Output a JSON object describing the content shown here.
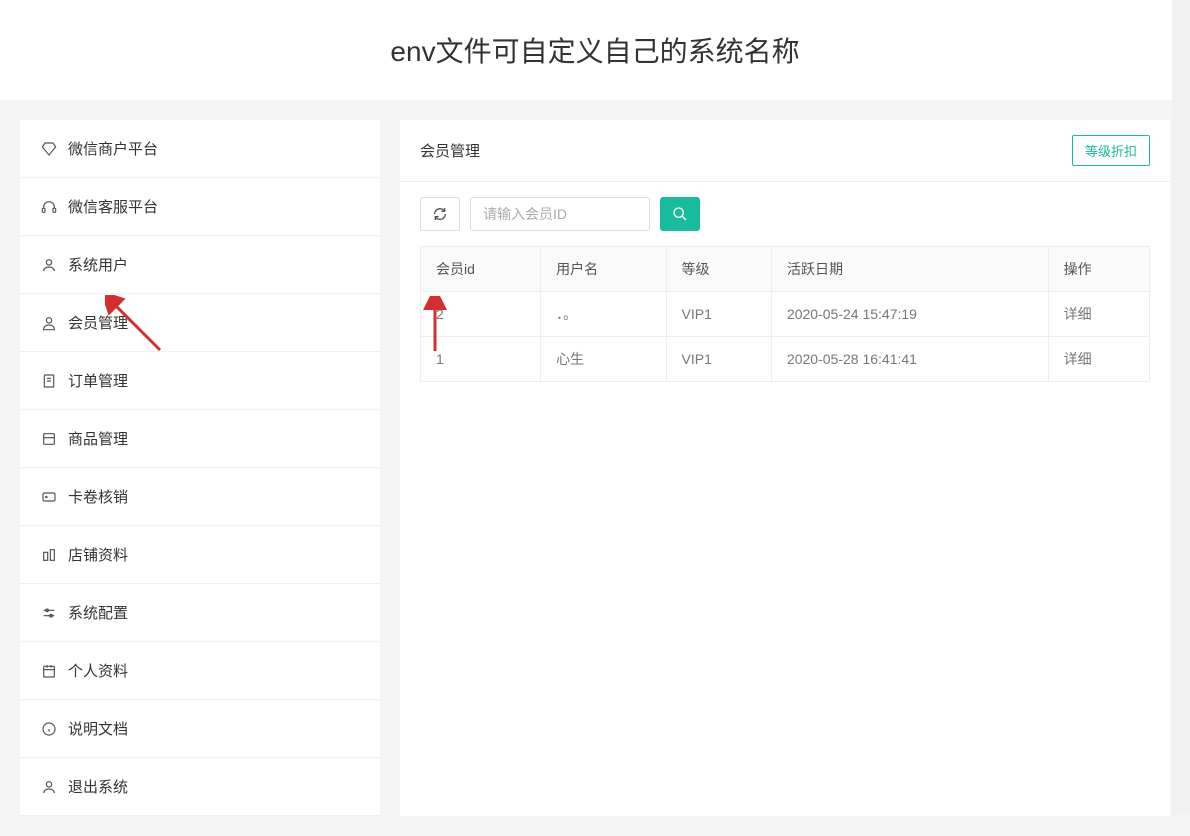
{
  "header": {
    "title": "env文件可自定义自己的系统名称"
  },
  "sidebar": {
    "items": [
      {
        "label": "微信商户平台",
        "icon": "diamond-icon"
      },
      {
        "label": "微信客服平台",
        "icon": "headset-icon"
      },
      {
        "label": "系统用户",
        "icon": "user-icon"
      },
      {
        "label": "会员管理",
        "icon": "member-icon"
      },
      {
        "label": "订单管理",
        "icon": "order-icon"
      },
      {
        "label": "商品管理",
        "icon": "product-icon"
      },
      {
        "label": "卡卷核销",
        "icon": "card-icon"
      },
      {
        "label": "店铺资料",
        "icon": "shop-icon"
      },
      {
        "label": "系统配置",
        "icon": "settings-icon"
      },
      {
        "label": "个人资料",
        "icon": "profile-icon"
      },
      {
        "label": "说明文档",
        "icon": "info-icon"
      },
      {
        "label": "退出系统",
        "icon": "logout-icon"
      }
    ]
  },
  "main": {
    "title": "会员管理",
    "tier_button": "等级折扣",
    "search": {
      "placeholder": "请输入会员ID"
    },
    "table": {
      "columns": [
        "会员id",
        "用户名",
        "等级",
        "活跃日期",
        "操作"
      ],
      "rows": [
        {
          "id": "2",
          "username": "．。",
          "level": "VIP1",
          "date": "2020-05-24 15:47:19",
          "action": "详细"
        },
        {
          "id": "1",
          "username": "心生",
          "level": "VIP1",
          "date": "2020-05-28 16:41:41",
          "action": "详细"
        }
      ]
    }
  }
}
